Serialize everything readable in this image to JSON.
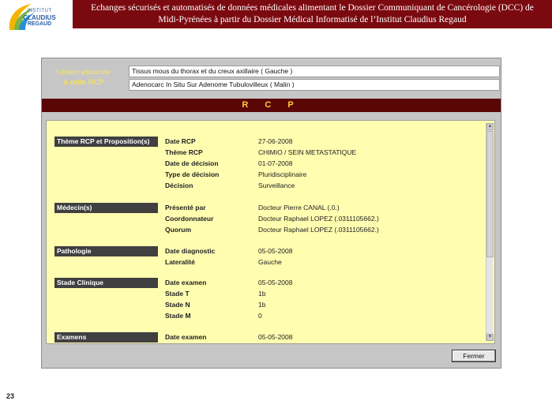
{
  "header": {
    "logo": {
      "line1": "INSTITUT",
      "line2": "CLAUDIUS",
      "line3": "REGAUD"
    },
    "banner_line1": "Echanges sécurisés et automatisés de données médicales alimentant le Dossier Communiquant de Cancérologie (DCC) de",
    "banner_line2": "Midi-Pyrénées à partir du Dossier Médical Informatisé de l’Institut Claudius Regaud"
  },
  "colors": {
    "banner": "#7b0a10",
    "label_yellow": "#ffe850",
    "panel": "#fffdb0",
    "rcp_bar": "#5a0606",
    "section_head": "#404040"
  },
  "lesion": {
    "label_line1": "Lésion associée",
    "label_line2": "à cette RCP",
    "field1": "Tissus mous du thorax et du creux axillaire   ( Gauche )",
    "field2": "Adenocarc In Situ Sur Adenome Tubulovilleux   ( Malin )"
  },
  "rcp_title": "R C P",
  "sections": {
    "theme": {
      "title": "Thème RCP et Proposition(s)",
      "rows": [
        {
          "label": "Date RCP",
          "value": "27-06-2008"
        },
        {
          "label": "Thème RCP",
          "value": "CHIMIO / SEIN METASTATIQUE"
        },
        {
          "label": "Date de décision",
          "value": "01-07-2008"
        },
        {
          "label": "Type de décision",
          "value": "Pluridisciplinaire"
        },
        {
          "label": "Décision",
          "value": "Surveillance"
        }
      ]
    },
    "medecins": {
      "title": "Médecin(s)",
      "rows": [
        {
          "label": "Présenté par",
          "value": "Docteur Pierre CANAL  (.0.)"
        },
        {
          "label": "Coordonnateur",
          "value": "Docteur Raphael LOPEZ  (.0311105662.)"
        },
        {
          "label": "Quorum",
          "value": "Docteur Raphael LOPEZ  (.0311105662.)"
        }
      ]
    },
    "pathologie": {
      "title": "Pathologie",
      "rows": [
        {
          "label": "Date diagnostic",
          "value": "05-05-2008"
        },
        {
          "label": "Lateralité",
          "value": "Gauche"
        }
      ]
    },
    "stade": {
      "title": "Stade Clinique",
      "rows": [
        {
          "label": "Date examen",
          "value": "05-05-2008"
        },
        {
          "label": "Stade T",
          "value": "1b"
        },
        {
          "label": "Stade N",
          "value": "1b"
        },
        {
          "label": "Stade M",
          "value": "0"
        }
      ]
    },
    "examens": {
      "title": "Examens",
      "rows": [
        {
          "label": "Date examen",
          "value": "05-05-2008"
        }
      ]
    }
  },
  "fermer_label": "Fermer",
  "page_number": "23"
}
